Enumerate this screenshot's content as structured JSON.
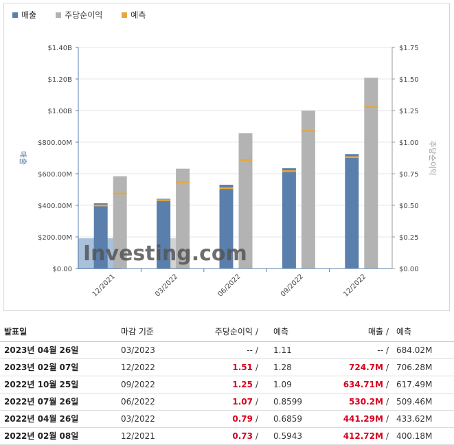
{
  "legend": {
    "revenue": "매출",
    "eps": "주당순이익",
    "forecast": "예측"
  },
  "colors": {
    "revenue": "#5b7fac",
    "eps": "#b3b3b3",
    "forecast": "#e8a838",
    "actual_up": "#d8001e"
  },
  "chart_data": {
    "type": "bar",
    "categories": [
      "12/2021",
      "03/2022",
      "06/2022",
      "09/2022",
      "12/2022"
    ],
    "ylabel": "매출",
    "y2label": "주당순이익",
    "ylim": [
      0,
      1400000000
    ],
    "y2lim": [
      0,
      1.75
    ],
    "yticks": [
      "$0.00",
      "$200.00M",
      "$400.00M",
      "$600.00M",
      "$800.00M",
      "$1.00B",
      "$1.20B",
      "$1.40B"
    ],
    "y2ticks": [
      "$0.00",
      "$0.25",
      "$0.50",
      "$0.75",
      "$1.00",
      "$1.25",
      "$1.50",
      "$1.75"
    ],
    "series": [
      {
        "name": "매출",
        "axis": "left",
        "values": [
          412720000,
          441290000,
          530200000,
          634710000,
          724700000
        ],
        "forecast": [
          400180000,
          433620000,
          509460000,
          617490000,
          706280000
        ]
      },
      {
        "name": "주당순이익",
        "axis": "right",
        "values": [
          0.73,
          0.79,
          1.07,
          1.25,
          1.51
        ],
        "forecast": [
          0.5943,
          0.6859,
          0.8599,
          1.09,
          1.28
        ]
      }
    ],
    "watermark": "Investing.com"
  },
  "table": {
    "headers": {
      "date": "발표일",
      "period": "마감 기준",
      "eps": "주당순이익",
      "eps_forecast": "예측",
      "revenue": "매출",
      "revenue_forecast": "예측"
    },
    "slash": "/",
    "rows": [
      {
        "date": "2023년 04월 26일",
        "period": "03/2023",
        "eps": "--",
        "eps_forecast": "1.11",
        "revenue": "--",
        "revenue_forecast": "684.02M",
        "pending": true
      },
      {
        "date": "2023년 02월 07일",
        "period": "12/2022",
        "eps": "1.51",
        "eps_forecast": "1.28",
        "revenue": "724.7M",
        "revenue_forecast": "706.28M",
        "pending": false
      },
      {
        "date": "2022년 10월 25일",
        "period": "09/2022",
        "eps": "1.25",
        "eps_forecast": "1.09",
        "revenue": "634.71M",
        "revenue_forecast": "617.49M",
        "pending": false
      },
      {
        "date": "2022년 07월 26일",
        "period": "06/2022",
        "eps": "1.07",
        "eps_forecast": "0.8599",
        "revenue": "530.2M",
        "revenue_forecast": "509.46M",
        "pending": false
      },
      {
        "date": "2022년 04월 26일",
        "period": "03/2022",
        "eps": "0.79",
        "eps_forecast": "0.6859",
        "revenue": "441.29M",
        "revenue_forecast": "433.62M",
        "pending": false
      },
      {
        "date": "2022년 02월 08일",
        "period": "12/2021",
        "eps": "0.73",
        "eps_forecast": "0.5943",
        "revenue": "412.72M",
        "revenue_forecast": "400.18M",
        "pending": false
      }
    ]
  }
}
